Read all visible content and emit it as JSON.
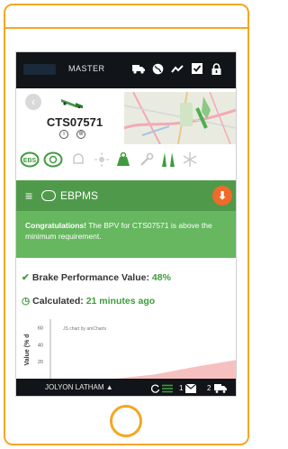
{
  "header": {
    "mode_label": "MASTER",
    "icons": [
      "truck-icon",
      "globe-icon",
      "chart-line-icon",
      "checkbox-icon",
      "lock-icon"
    ]
  },
  "vehicle": {
    "name": "CTS07571"
  },
  "ebpms": {
    "title": "EBPMS",
    "message_prefix": "Congratulations!",
    "message_body": "The BPV for CTS07571 is above the minimum requirement."
  },
  "bpv": {
    "label": "Brake Performance Value:",
    "value": "48%"
  },
  "calculated": {
    "label": "Calculated:",
    "value": "21 minutes ago"
  },
  "chart_data": {
    "type": "area",
    "credit": "JS chart by amCharts",
    "ylabel": "Value (% d",
    "y_ticks": [
      "60",
      "40",
      "20"
    ],
    "series": [
      {
        "color": "#f6b9b9",
        "values": [
          0,
          5,
          14,
          22
        ]
      }
    ]
  },
  "footer": {
    "user": "JOLYON LATHAM ▲",
    "mail_count": "1",
    "truck_count": "2"
  },
  "colors": {
    "accent": "#f5a623",
    "green": "#4f9a4a",
    "banner_green": "#66b75f",
    "orange_button": "#f06a2a",
    "dark_bar": "#111418"
  }
}
